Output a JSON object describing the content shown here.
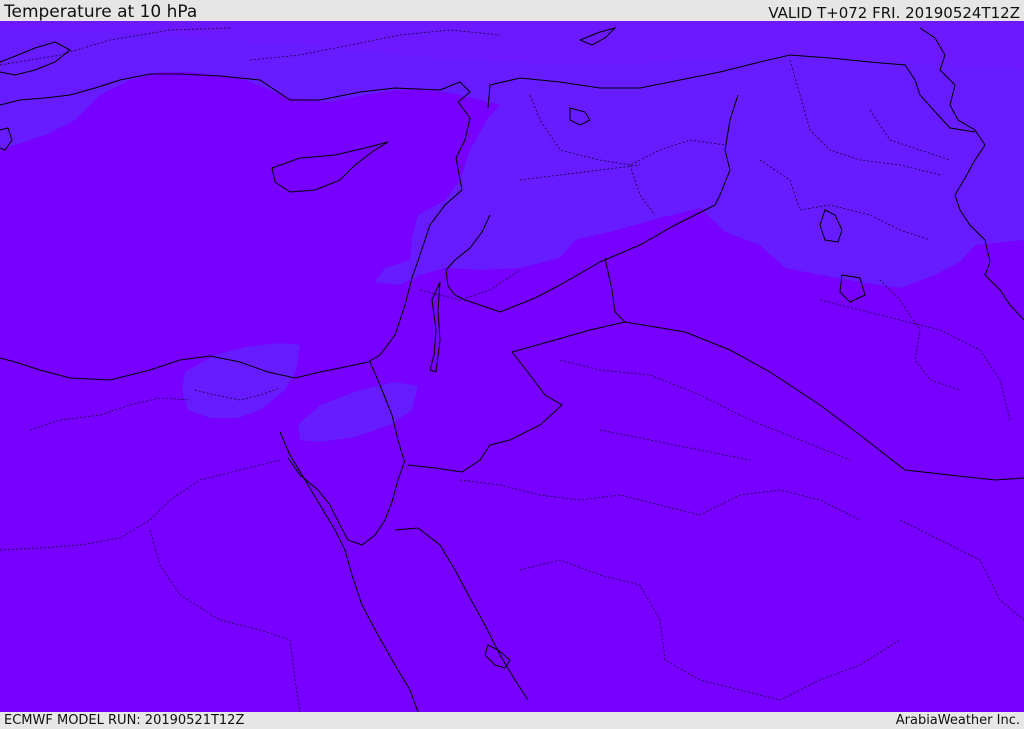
{
  "header": {
    "title": "Temperature at 10 hPa",
    "valid": "VALID T+072 FRI. 20190524T12Z"
  },
  "footer": {
    "model_run": "ECMWF MODEL RUN: 20190521T12Z",
    "credit": "ArabiaWeather Inc."
  },
  "colors": {
    "warm_field": "#7700ff",
    "cool_field": "#661cff",
    "coastline": "#000000",
    "frame": "#e6e6e6"
  }
}
